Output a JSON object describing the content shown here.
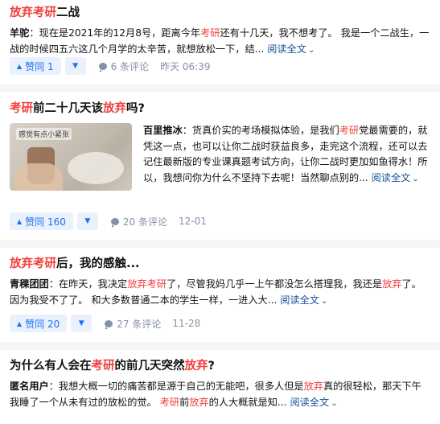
{
  "items": [
    {
      "title": [
        {
          "t": "放弃考研",
          "hl": true
        },
        {
          "t": "二战",
          "hl": false
        }
      ],
      "author": "羊驼",
      "excerpt": [
        {
          "t": "：现在是2021年的12月8号，距离今年",
          "hl": false
        },
        {
          "t": "考研",
          "hl": true
        },
        {
          "t": "还有十几天，我不想考了。 我是一个二战生，一战的时候四五六这几个月学的太辛苦，就想放松一下，结...",
          "hl": false
        }
      ],
      "more_label": "阅读全文",
      "vote_label": "赞同 1",
      "comments_label": "6 条评论",
      "time": "昨天 06:39"
    },
    {
      "title": [
        {
          "t": "考研",
          "hl": true
        },
        {
          "t": "前二十几天该",
          "hl": false
        },
        {
          "t": "放弃",
          "hl": true
        },
        {
          "t": "吗?",
          "hl": false
        }
      ],
      "thumb_caption": "感觉有点小紧张",
      "author": "百里推冰",
      "excerpt": [
        {
          "t": "：货真价实的考场模拟体验，是我们",
          "hl": false
        },
        {
          "t": "考研",
          "hl": true
        },
        {
          "t": "党最需要的，就凭这一点，也可以让你二战时获益良多，走完这个流程，还可以去记住最新版的专业课真题考试方向，让你二战时更加如鱼得水！所以，我想问你为什么不坚持下去呢！当然聊点别的...",
          "hl": false
        }
      ],
      "more_label": "阅读全文",
      "vote_label": "赞同 160",
      "comments_label": "20 条评论",
      "time": "12-01"
    },
    {
      "title": [
        {
          "t": "放弃考研",
          "hl": true
        },
        {
          "t": "后，我的感触...",
          "hl": false
        }
      ],
      "author": "青稞团团",
      "excerpt": [
        {
          "t": "：在昨天，我决定",
          "hl": false
        },
        {
          "t": "放弃考研",
          "hl": true
        },
        {
          "t": "了，尽管我妈几乎一上午都没怎么搭理我，我还是",
          "hl": false
        },
        {
          "t": "放弃",
          "hl": true
        },
        {
          "t": "了。因为我受不了了。 和大多数普通二本的学生一样，一进入大...",
          "hl": false
        }
      ],
      "more_label": "阅读全文",
      "vote_label": "赞同 20",
      "comments_label": "27 条评论",
      "time": "11-28"
    },
    {
      "title": [
        {
          "t": "为什么有人会在",
          "hl": false
        },
        {
          "t": "考研",
          "hl": true
        },
        {
          "t": "的前几天突然",
          "hl": false
        },
        {
          "t": "放弃",
          "hl": true
        },
        {
          "t": "?",
          "hl": false
        }
      ],
      "author": "匿名用户",
      "excerpt": [
        {
          "t": "：我想大概一切的痛苦都是源于自己的无能吧，很多人但是",
          "hl": false
        },
        {
          "t": "放弃",
          "hl": true
        },
        {
          "t": "真的很轻松，那天下午我睡了一个从未有过的放松的觉。 ",
          "hl": false
        },
        {
          "t": "考研",
          "hl": true
        },
        {
          "t": "前",
          "hl": false
        },
        {
          "t": "放弃",
          "hl": true
        },
        {
          "t": "的人大概就是知...",
          "hl": false
        }
      ],
      "more_label": "阅读全文"
    }
  ],
  "colors": {
    "highlight": "#f1403c",
    "link": "#175199",
    "vote_text": "#1772f6",
    "vote_bg": "#eaf1fc",
    "meta": "#8590a6"
  },
  "icons": {
    "upvote": "triangle-up-icon",
    "downvote": "triangle-down-icon",
    "comment": "comment-bubble-icon",
    "more": "chevron-down-icon"
  }
}
